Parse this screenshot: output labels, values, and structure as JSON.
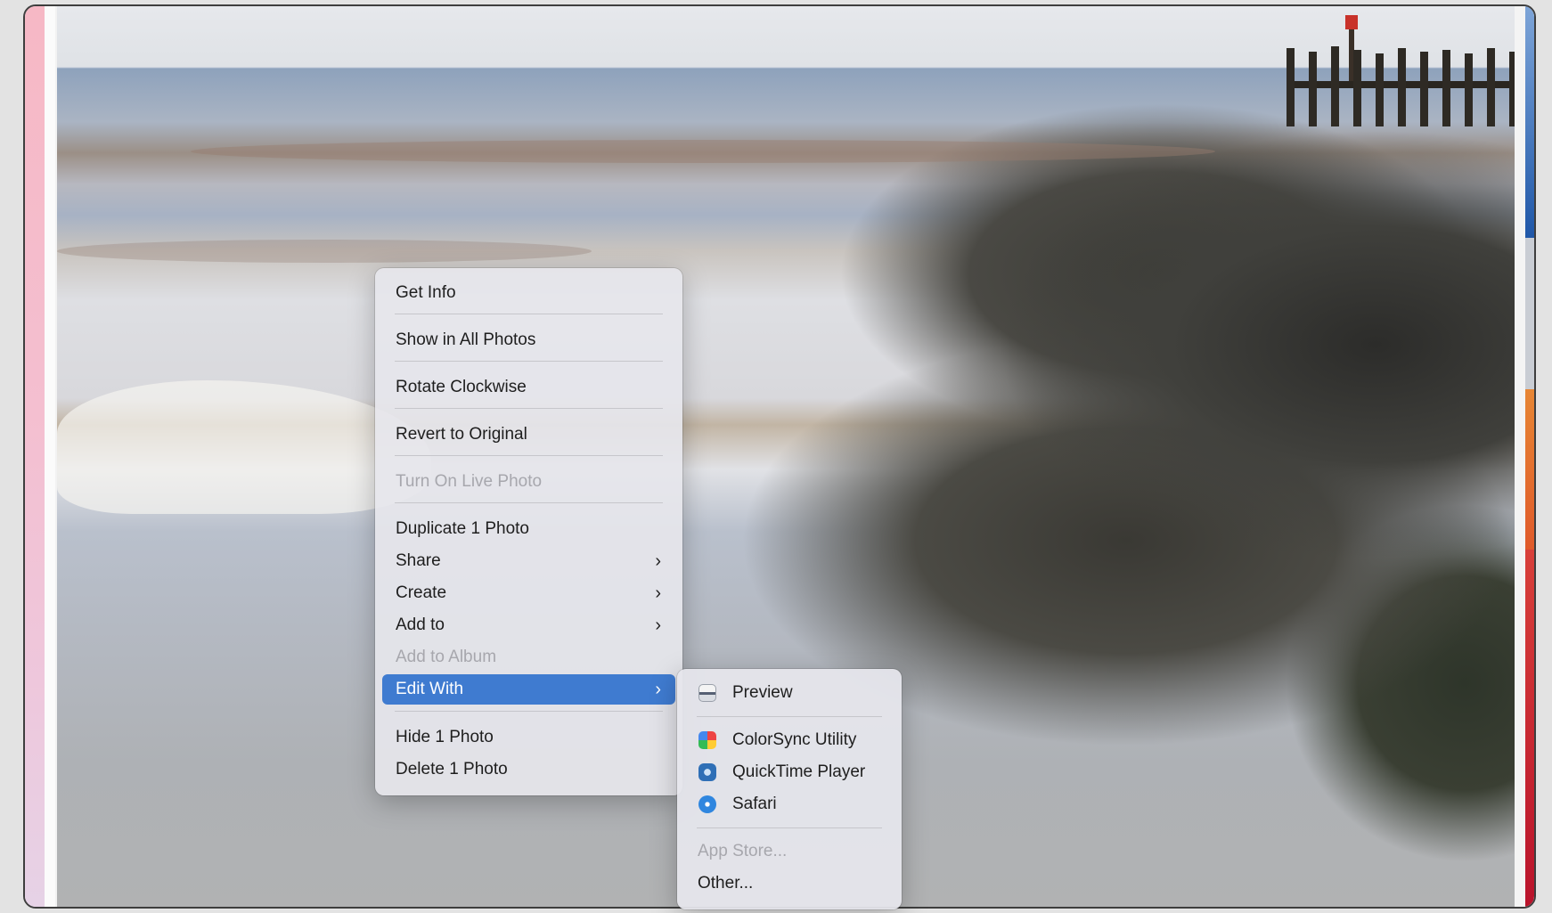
{
  "context_menu": {
    "items": [
      {
        "label": "Get Info"
      },
      {
        "label": "Show in All Photos"
      },
      {
        "label": "Rotate Clockwise"
      },
      {
        "label": "Revert to Original"
      },
      {
        "label": "Turn On Live Photo",
        "disabled": true
      },
      {
        "label": "Duplicate 1 Photo"
      },
      {
        "label": "Share",
        "submenu": true
      },
      {
        "label": "Create",
        "submenu": true
      },
      {
        "label": "Add to",
        "submenu": true
      },
      {
        "label": "Add to Album",
        "disabled": true
      },
      {
        "label": "Edit With",
        "submenu": true,
        "highlighted": true
      },
      {
        "label": "Hide 1 Photo"
      },
      {
        "label": "Delete 1 Photo"
      }
    ],
    "submenu_chevron": "›"
  },
  "edit_with_submenu": {
    "items": [
      {
        "label": "Preview",
        "icon": "preview-icon"
      },
      {
        "label": "ColorSync Utility",
        "icon": "colorsync-utility-icon"
      },
      {
        "label": "QuickTime Player",
        "icon": "quicktime-player-icon"
      },
      {
        "label": "Safari",
        "icon": "safari-icon"
      },
      {
        "label": "App Store...",
        "disabled": true
      },
      {
        "label": "Other..."
      }
    ]
  },
  "colors": {
    "highlight": "#3f7bd0",
    "menu_background": "#e6e6ec",
    "disabled_text": "#a7a7ad"
  }
}
